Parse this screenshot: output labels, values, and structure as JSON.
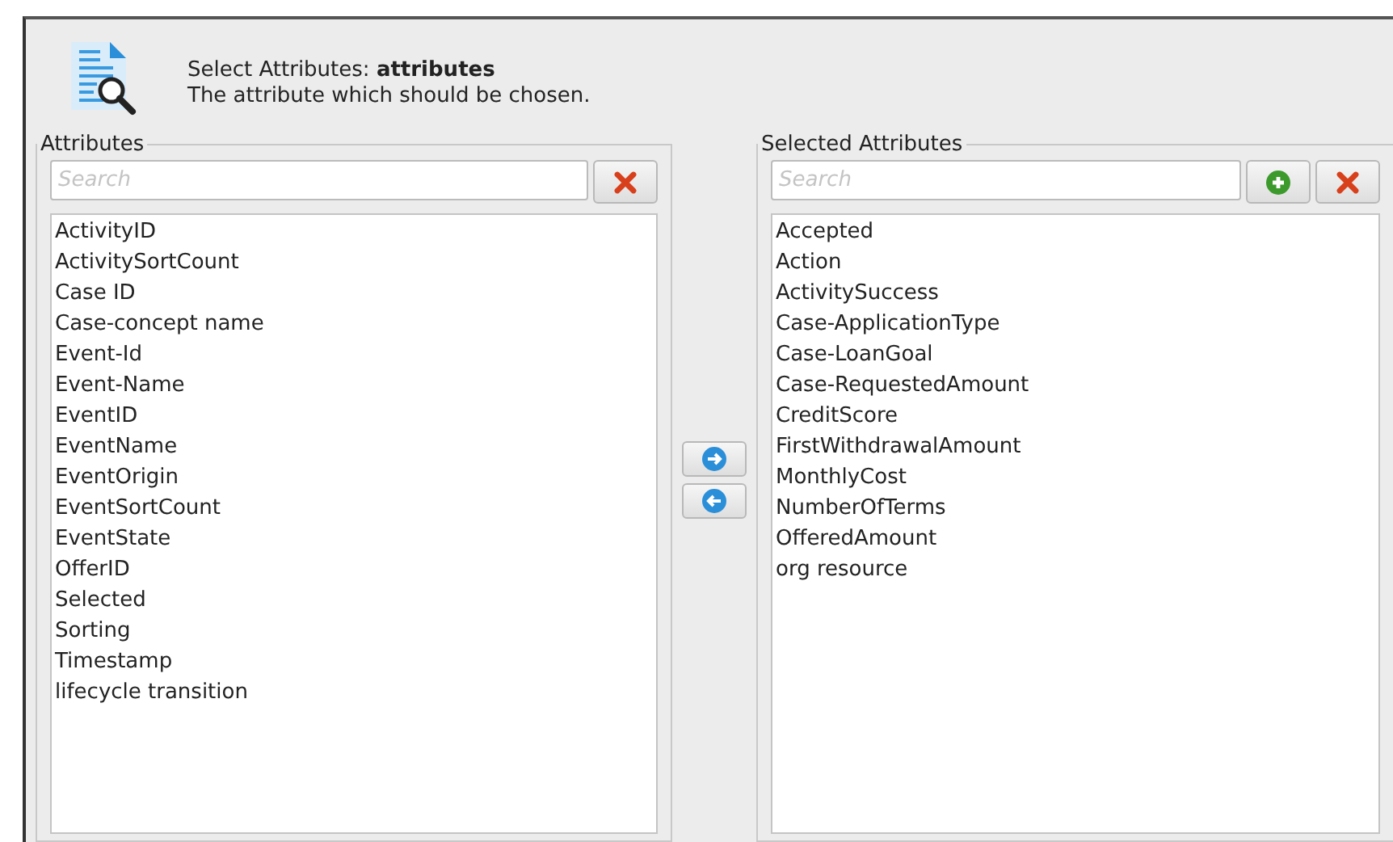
{
  "header": {
    "title": "Select Attributes: **attributes**",
    "subtitle": "The attribute which should be chosen."
  },
  "available": {
    "legend": "Attributes",
    "search": {
      "placeholder": "Search"
    },
    "buttons": [
      {
        "kind": "clear"
      }
    ],
    "items": [
      "ActivityID",
      "ActivitySortCount",
      "Case ID",
      "Case-concept name",
      "Event-Id",
      "Event-Name",
      "EventID",
      "EventName",
      "EventOrigin",
      "EventSortCount",
      "EventState",
      "OfferID",
      "Selected",
      "Sorting",
      "Timestamp",
      "lifecycle transition"
    ]
  },
  "transfer_buttons": [
    {
      "kind": "add"
    },
    {
      "kind": "remove"
    }
  ],
  "selected": {
    "legend": "Selected Attributes",
    "search": {
      "placeholder": "Search"
    },
    "buttons": [
      {
        "kind": "new"
      },
      {
        "kind": "clear"
      }
    ],
    "items": [
      "Accepted",
      "Action",
      "ActivitySuccess",
      "Case-ApplicationType",
      "Case-LoanGoal",
      "Case-RequestedAmount",
      "CreditScore",
      "FirstWithdrawalAmount",
      "MonthlyCost",
      "NumberOfTerms",
      "OfferedAmount",
      "org resource"
    ]
  }
}
